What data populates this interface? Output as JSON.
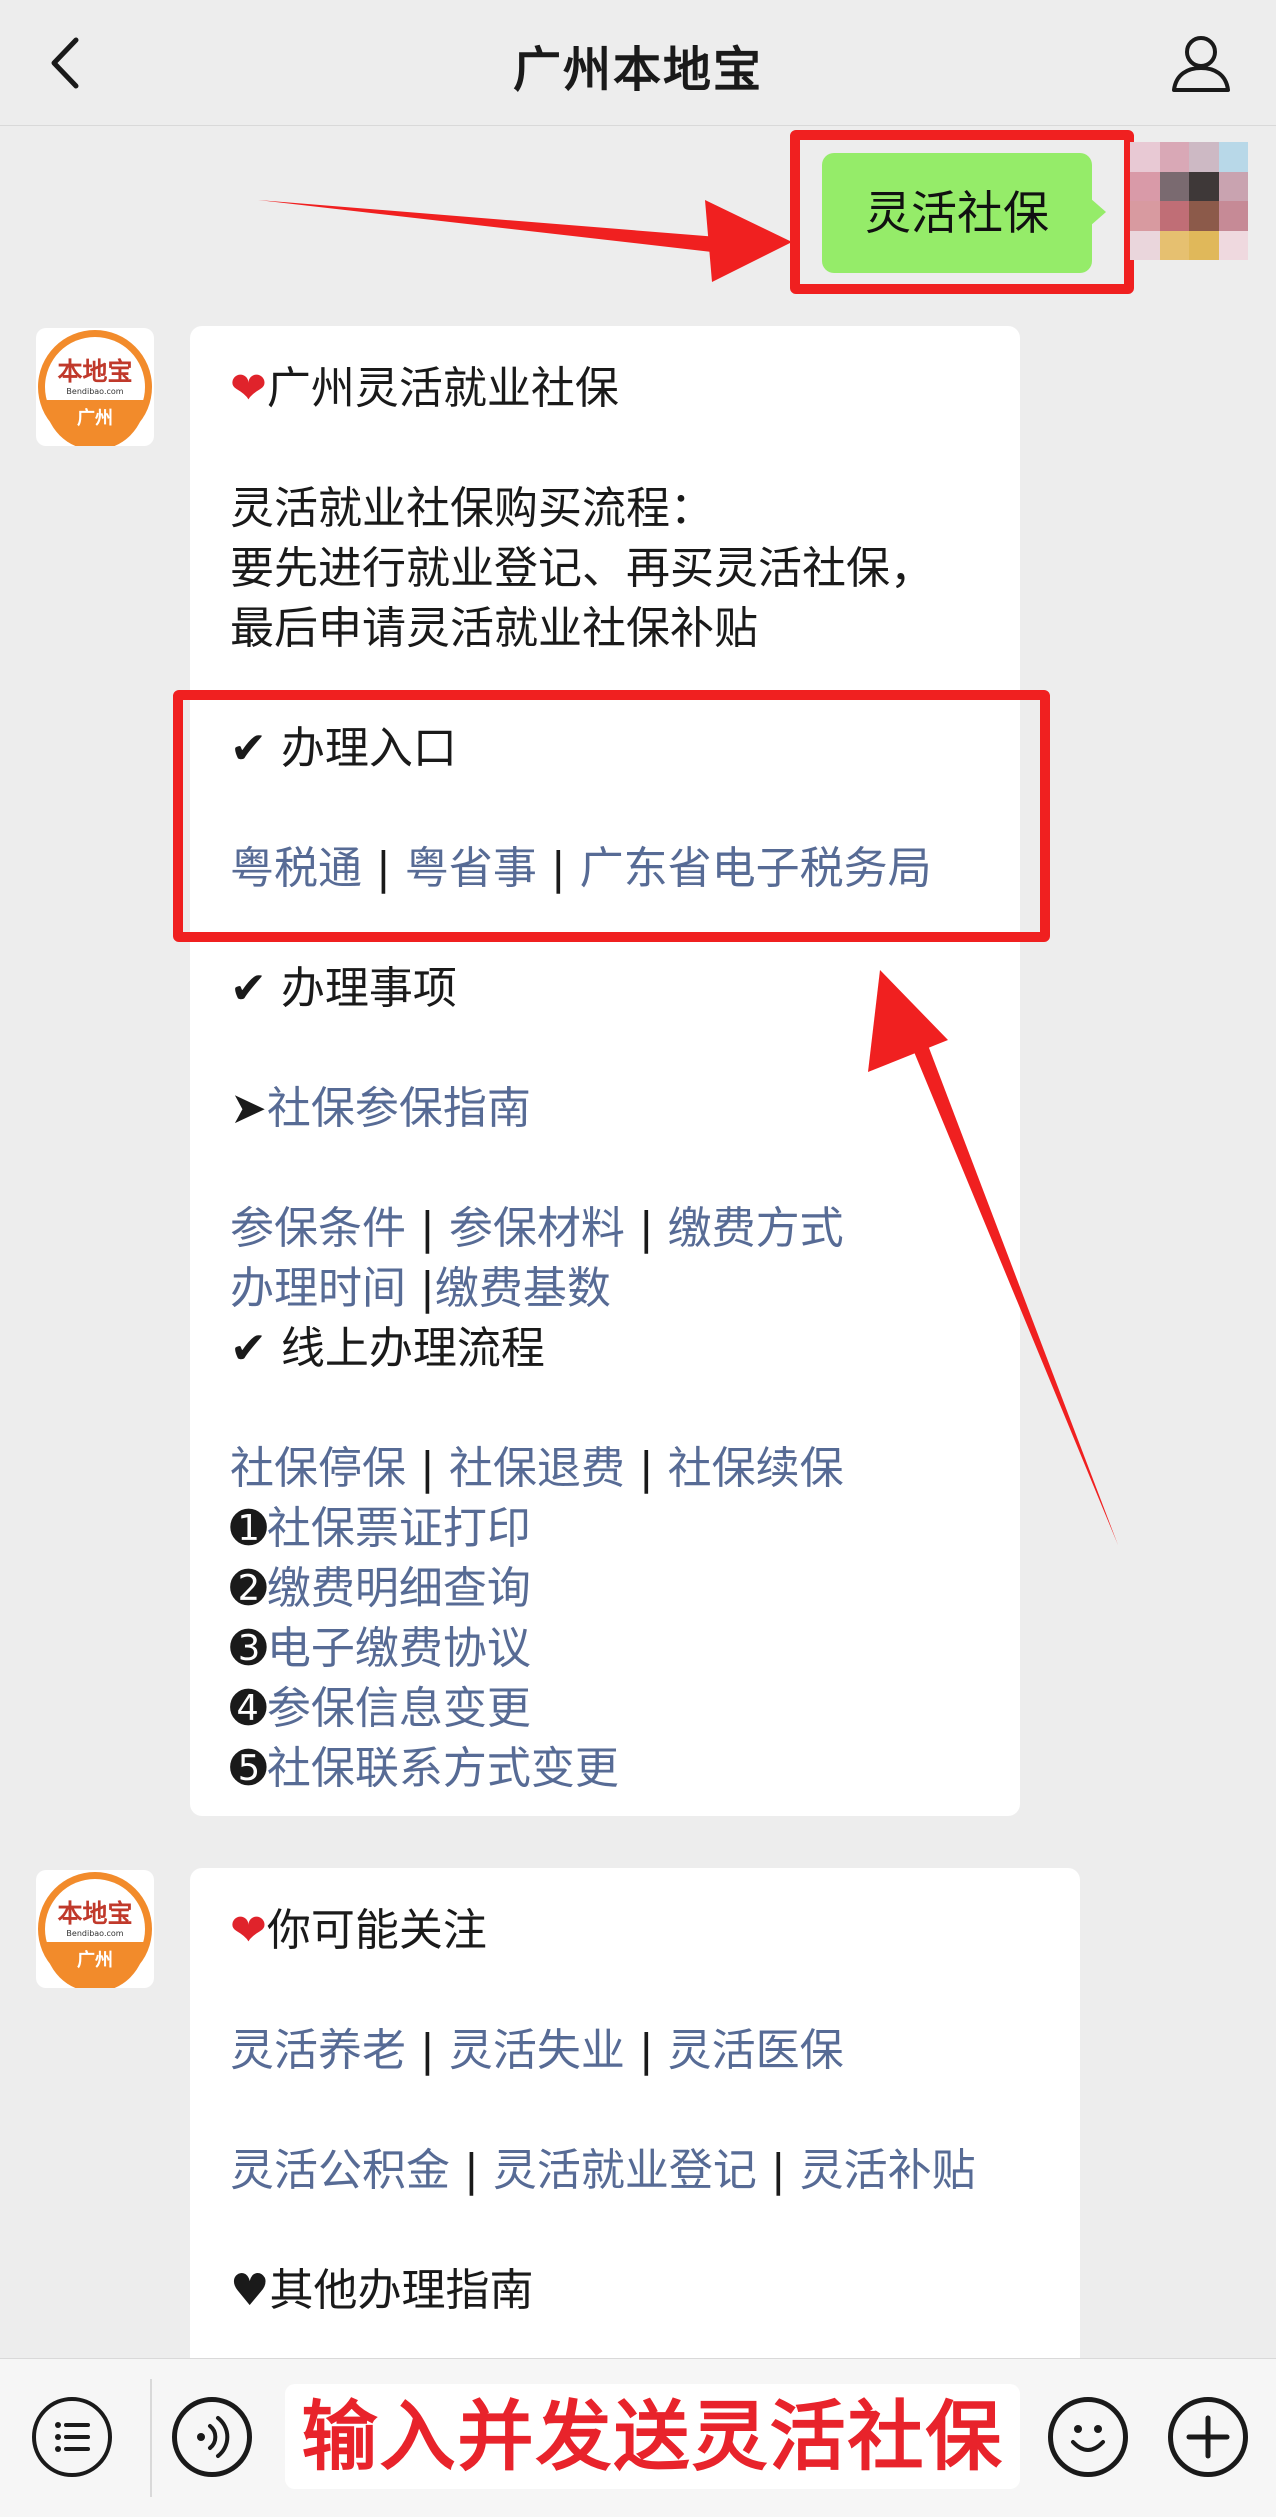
{
  "header": {
    "title": "广州本地宝",
    "back_icon": "chevron-left-icon",
    "profile_icon": "person-icon"
  },
  "outgoing": {
    "text": "灵活社保"
  },
  "bot": {
    "logo_top": "本地宝",
    "logo_sub": "Bendibao.com",
    "logo_city": "广州",
    "brand_color": "#f28b2b"
  },
  "msg1": {
    "heading": "广州灵活就业社保",
    "intro": [
      "灵活就业社保购买流程：",
      "要先进行就业登记、再买灵活社保，",
      "最后申请灵活就业社保补贴"
    ],
    "entry_title": "办理入口",
    "entry_links": [
      "粤税通",
      "粤省事",
      "广东省电子税务局"
    ],
    "matters_title": "办理事项",
    "guide_link": "社保参保指南",
    "guide_links_row1": [
      "参保条件",
      "参保材料",
      "缴费方式"
    ],
    "guide_links_row2": [
      "办理时间",
      "缴费基数"
    ],
    "online_title": "线上办理流程",
    "online_links": [
      "社保停保",
      "社保退费",
      "社保续保"
    ],
    "numbered": [
      {
        "num": "➊",
        "text": "社保票证打印"
      },
      {
        "num": "➋",
        "text": "缴费明细查询"
      },
      {
        "num": "➌",
        "text": "电子缴费协议"
      },
      {
        "num": "➍",
        "text": "参保信息变更"
      },
      {
        "num": "➎",
        "text": "社保联系方式变更"
      }
    ]
  },
  "msg2": {
    "heading": "你可能关注",
    "row1": [
      "灵活养老",
      "灵活失业",
      "灵活医保"
    ],
    "row2": [
      "灵活公积金",
      "灵活就业登记",
      "灵活补贴"
    ],
    "other": "其他办理指南"
  },
  "symbols": {
    "heart": "❤",
    "check": "✔",
    "arrow": "➤",
    "black_heart": "♥",
    "sep": "|"
  },
  "input_bar": {
    "voice_icon": "voice-icon",
    "emoji_icon": "emoji-icon",
    "plus_icon": "plus-icon",
    "menu_icon": "menu-icon",
    "input_text": "输入并发送灵活社保"
  },
  "colors": {
    "highlight": "#f02020",
    "link": "#576b95",
    "bubble_out": "#95ec69",
    "input_text": "#e8232b"
  }
}
